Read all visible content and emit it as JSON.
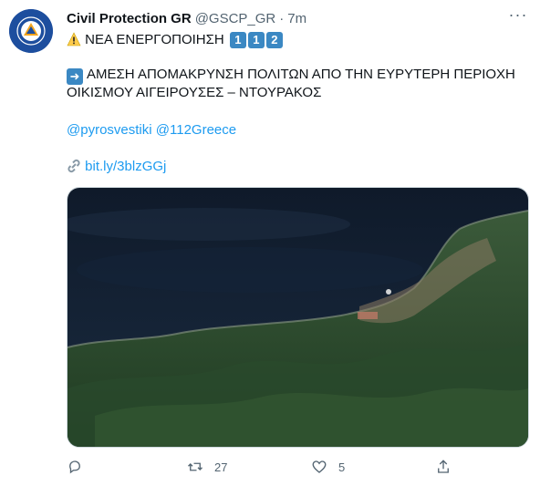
{
  "account": {
    "name": "Civil Protection GR",
    "handle": "@GSCP_GR",
    "separator": "·",
    "time": "7m",
    "avatar_colors": {
      "bg": "#1d4e9e",
      "ring": "#ffffff",
      "triangle": "#f4a41c"
    }
  },
  "tweet": {
    "line1": {
      "icon": "warning-icon",
      "text": "ΝΕΑ ΕΝΕΡΓΟΠΟΙΗΣΗ",
      "keys": [
        "1",
        "1",
        "2"
      ]
    },
    "line2": {
      "icon": "right-arrow-icon",
      "text_a": "ΑΜΕΣΗ ΑΠΟΜΑΚΡΥΝΣΗ ΠΟΛΙΤΩΝ ΑΠΟ ΤΗΝ ΕΥΡΥΤΕΡΗ ΠΕΡΙΟΧΗ",
      "text_b": "ΟΙΚΙΣΜΟΥ ΑΙΓΕΙΡΟΥΣΕΣ – ΝΤΟΥΡΑΚΟΣ"
    },
    "mentions": [
      "@pyrosvestiki",
      "@112Greece"
    ],
    "link": {
      "icon": "link-icon",
      "text": "bit.ly/3blzGGj"
    },
    "media": {
      "type": "satellite-map-image"
    }
  },
  "actions": {
    "reply": {
      "icon": "reply-icon",
      "count": ""
    },
    "retweet": {
      "icon": "retweet-icon",
      "count": "27"
    },
    "like": {
      "icon": "heart-icon",
      "count": "5"
    },
    "share": {
      "icon": "share-icon"
    }
  },
  "colors": {
    "link": "#1d9bf0",
    "muted": "#536471",
    "key_bg": "#3b88c3"
  }
}
